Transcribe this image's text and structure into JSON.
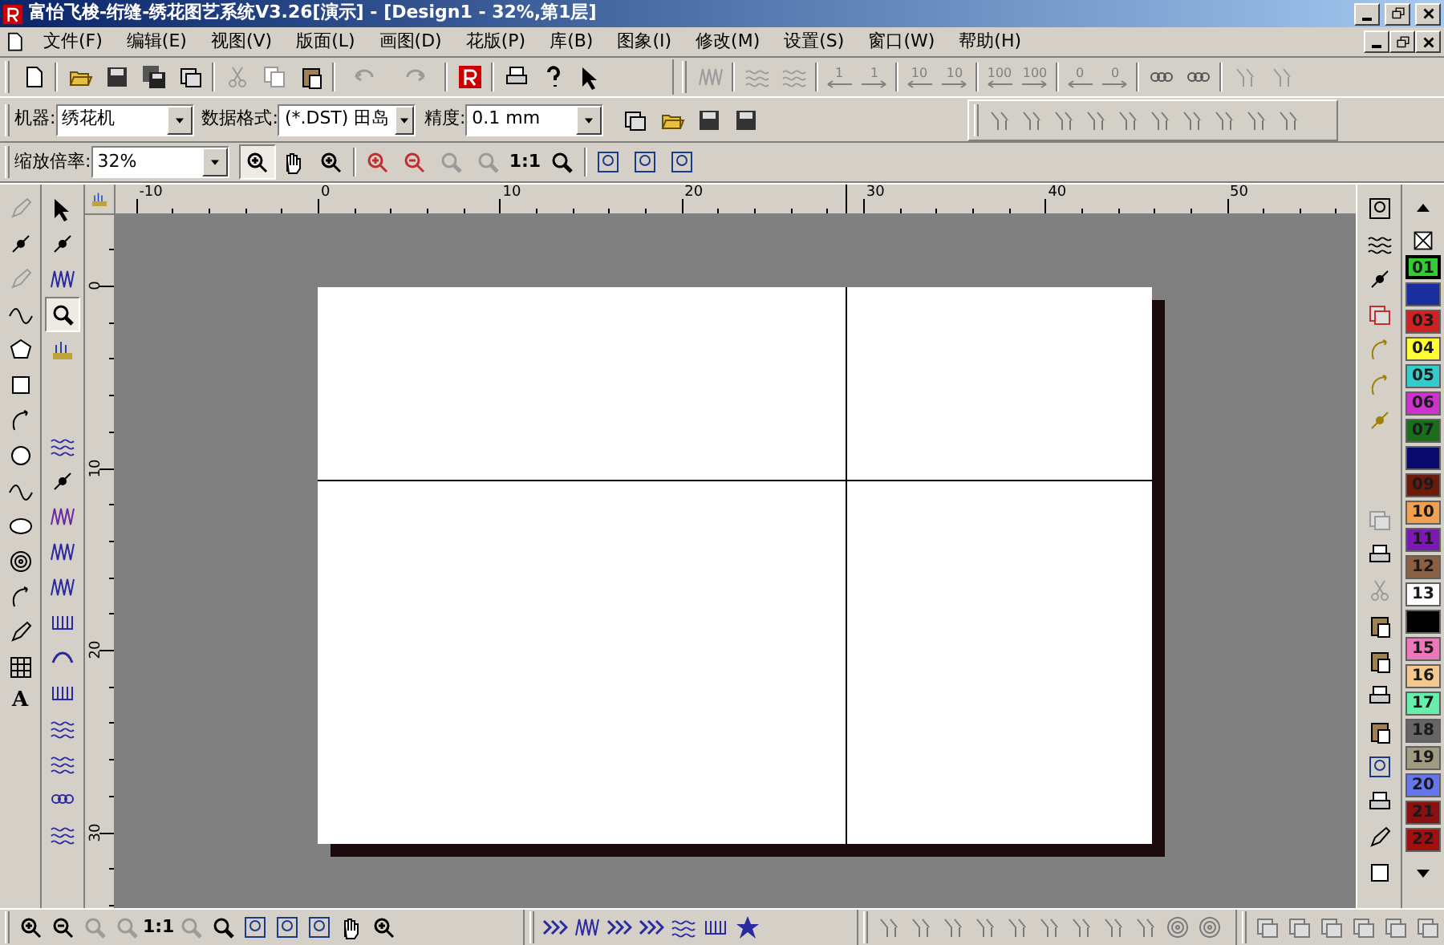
{
  "window": {
    "title": "富怡飞梭-绗缝-绣花图艺系统V3.26[演示] - [Design1 - 32%,第1层]"
  },
  "menu": [
    {
      "label": "文件(F)"
    },
    {
      "label": "编辑(E)"
    },
    {
      "label": "视图(V)"
    },
    {
      "label": "版面(L)"
    },
    {
      "label": "画图(D)"
    },
    {
      "label": "花版(P)"
    },
    {
      "label": "库(B)"
    },
    {
      "label": "图象(I)"
    },
    {
      "label": "修改(M)"
    },
    {
      "label": "设置(S)"
    },
    {
      "label": "窗口(W)"
    },
    {
      "label": "帮助(H)"
    }
  ],
  "step_buttons": [
    {
      "label": "1",
      "kind": "left"
    },
    {
      "label": "1",
      "kind": "right"
    },
    {
      "label": "10",
      "kind": "left"
    },
    {
      "label": "10",
      "kind": "right"
    },
    {
      "label": "100",
      "kind": "left"
    },
    {
      "label": "100",
      "kind": "right"
    },
    {
      "label": "0",
      "kind": "left"
    },
    {
      "label": "0",
      "kind": "right"
    }
  ],
  "machine_bar": {
    "machine": {
      "label": "机器:",
      "value": "绣花机"
    },
    "format": {
      "label": "数据格式:",
      "value": "(*.DST) 田岛"
    },
    "precision": {
      "label": "精度:",
      "value": "0.1 mm"
    }
  },
  "zoom_bar": {
    "label": "缩放倍率:",
    "value": "32%",
    "zoom_tool_selected": true,
    "actual_size_label": "1:1"
  },
  "edit_tools": {
    "magnifier_selected": true
  },
  "text_tool": {
    "label": "A"
  },
  "rulers": {
    "horizontal": [
      "-10",
      "0",
      "10",
      "20",
      "30",
      "40",
      "50"
    ],
    "vertical": [
      "0",
      "10",
      "20",
      "30"
    ]
  },
  "palette": [
    {
      "label": "01",
      "color": "#33cc33",
      "selected": true
    },
    {
      "color": "#1a2ea0",
      "selected": false
    },
    {
      "label": "03",
      "color": "#cc2222",
      "selected": false
    },
    {
      "label": "04",
      "color": "#ffff33",
      "selected": false
    },
    {
      "label": "05",
      "color": "#33cccc",
      "selected": false
    },
    {
      "label": "06",
      "color": "#cc33cc",
      "selected": false
    },
    {
      "label": "07",
      "color": "#1a6e1a",
      "selected": false
    },
    {
      "color": "#0a0a6e",
      "selected": false
    },
    {
      "label": "09",
      "color": "#6e1a0a",
      "selected": false
    },
    {
      "label": "10",
      "color": "#f0a050",
      "selected": false
    },
    {
      "label": "11",
      "color": "#7a1ab0",
      "selected": false
    },
    {
      "label": "12",
      "color": "#8a6040",
      "selected": false
    },
    {
      "label": "13",
      "color": "#ffffff",
      "selected": false
    },
    {
      "color": "#000000",
      "selected": false
    },
    {
      "label": "15",
      "color": "#ee77bb",
      "selected": false
    },
    {
      "label": "16",
      "color": "#f5c890",
      "selected": false
    },
    {
      "label": "17",
      "color": "#66eeaa",
      "selected": false
    },
    {
      "label": "18",
      "color": "#666666",
      "selected": false
    },
    {
      "label": "19",
      "color": "#a09a80",
      "selected": false
    },
    {
      "label": "20",
      "color": "#6677ee",
      "selected": false
    },
    {
      "label": "21",
      "color": "#8b1010",
      "selected": false
    },
    {
      "label": "22",
      "color": "#a01010",
      "selected": false
    }
  ],
  "status_toolbar": {
    "actual_size_label": "1:1"
  }
}
